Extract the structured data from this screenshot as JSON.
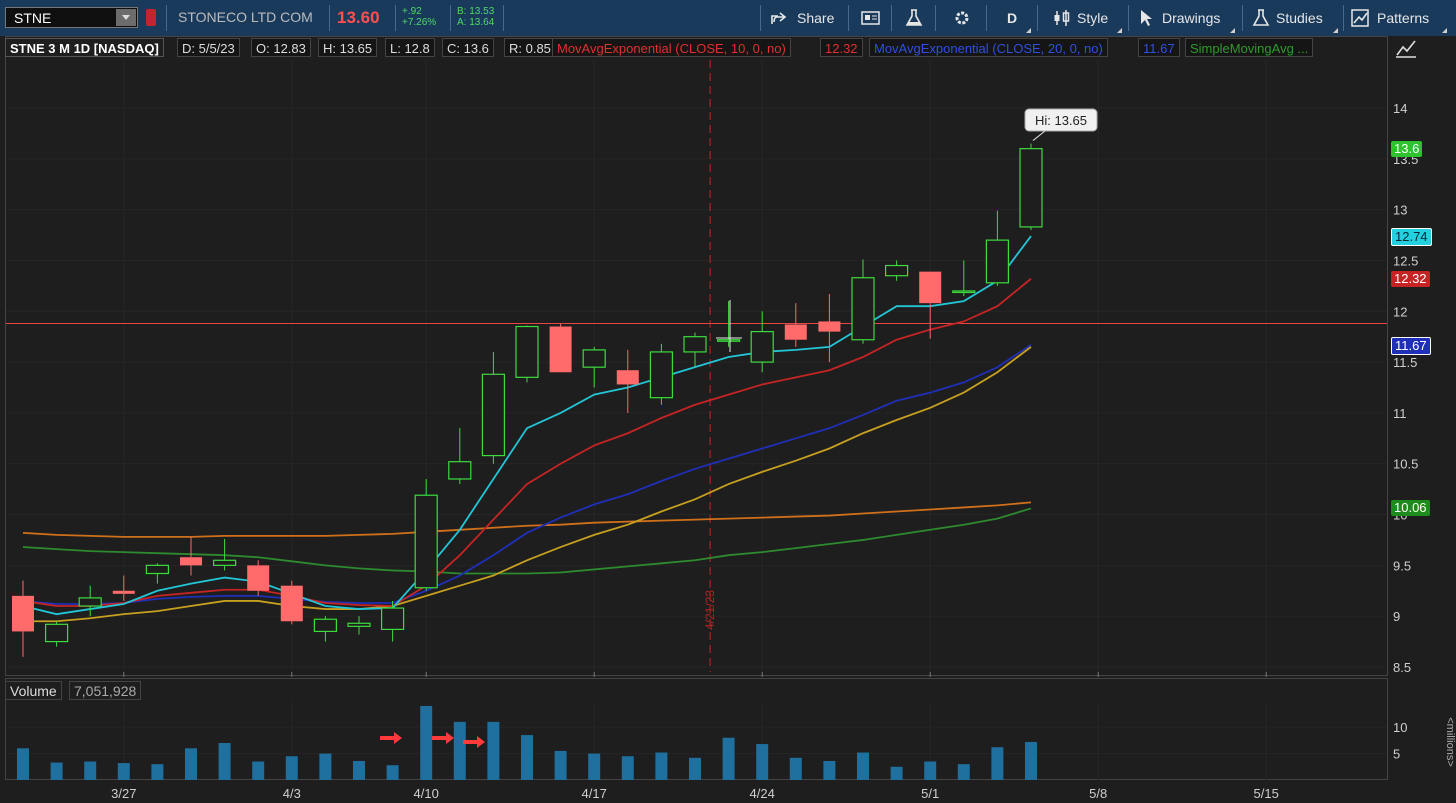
{
  "toolbar": {
    "symbol": "STNE",
    "company": "STONECO LTD COM",
    "last_price": "13.60",
    "change": "+.92",
    "change_pct": "+7.26%",
    "bid": "B: 13.53",
    "ask": "A: 13.64",
    "share_label": "Share",
    "timeframe_label": "D",
    "style_label": "Style",
    "drawings_label": "Drawings",
    "studies_label": "Studies",
    "patterns_label": "Patterns"
  },
  "studybar": {
    "title": "STNE 3 M 1D [NASDAQ]",
    "date": "D: 5/5/23",
    "open": "O: 12.83",
    "high": "H: 13.65",
    "low": "L: 12.8",
    "close": "C: 13.6",
    "range": "R: 0.85",
    "ema10_label": "MovAvgExponential (CLOSE, 10, 0, no)",
    "ema10_value": "12.32",
    "ema20_label": "MovAvgExponential (CLOSE, 20, 0, no)",
    "ema20_value": "11.67",
    "sma_label": "SimpleMovingAvg ..."
  },
  "volume_header": {
    "label": "Volume",
    "value": "7,051,928"
  },
  "price_labels": {
    "last": "13.6",
    "ema5": "12.74",
    "ema10": "12.32",
    "ema20": "11.67",
    "sma": "10.06"
  },
  "colors": {
    "up": "#3ddc3d",
    "down": "#ff6b6b",
    "ema5": "#22c6d6",
    "ema10": "#c62424",
    "ema20": "#1f2fb8",
    "sma1": "#c8a020",
    "sma2": "#d0701a",
    "sma3": "#2e8a2e",
    "volume": "#1f6f9f",
    "hline": "#e84545"
  },
  "chart_data": {
    "type": "candlestick",
    "title": "STNE 3 M 1D [NASDAQ]",
    "x_tick_labels": [
      "3/27",
      "4/3",
      "4/10",
      "4/17",
      "4/24",
      "5/1",
      "5/8",
      "5/15"
    ],
    "y_ticks": [
      8.5,
      9,
      9.5,
      10,
      10.5,
      11,
      11.5,
      12,
      12.5,
      13,
      13.5,
      14
    ],
    "ylim": [
      8.45,
      14.4
    ],
    "vertical_marker_date": "4/21/23",
    "horizontal_line": 11.88,
    "high_annotation": "Hi: 13.65",
    "candles": [
      {
        "date": "3/22",
        "o": 9.2,
        "h": 9.35,
        "l": 8.6,
        "c": 8.85
      },
      {
        "date": "3/23",
        "o": 8.75,
        "h": 8.95,
        "l": 8.7,
        "c": 8.92
      },
      {
        "date": "3/24",
        "o": 9.1,
        "h": 9.3,
        "l": 9.0,
        "c": 9.18
      },
      {
        "date": "3/27",
        "o": 9.25,
        "h": 9.4,
        "l": 9.15,
        "c": 9.22
      },
      {
        "date": "3/28",
        "o": 9.42,
        "h": 9.52,
        "l": 9.32,
        "c": 9.5
      },
      {
        "date": "3/29",
        "o": 9.58,
        "h": 9.78,
        "l": 9.4,
        "c": 9.5
      },
      {
        "date": "3/30",
        "o": 9.5,
        "h": 9.76,
        "l": 9.45,
        "c": 9.55
      },
      {
        "date": "3/31",
        "o": 9.5,
        "h": 9.55,
        "l": 9.2,
        "c": 9.25
      },
      {
        "date": "4/3",
        "o": 9.3,
        "h": 9.35,
        "l": 8.92,
        "c": 8.95
      },
      {
        "date": "4/4",
        "o": 8.85,
        "h": 9.0,
        "l": 8.75,
        "c": 8.97
      },
      {
        "date": "4/5",
        "o": 8.9,
        "h": 9.0,
        "l": 8.82,
        "c": 8.93
      },
      {
        "date": "4/6",
        "o": 8.87,
        "h": 9.15,
        "l": 8.75,
        "c": 9.08
      },
      {
        "date": "4/10",
        "o": 9.28,
        "h": 10.35,
        "l": 9.25,
        "c": 10.19
      },
      {
        "date": "4/11",
        "o": 10.35,
        "h": 10.85,
        "l": 10.3,
        "c": 10.52
      },
      {
        "date": "4/12",
        "o": 10.58,
        "h": 11.6,
        "l": 10.5,
        "c": 11.38
      },
      {
        "date": "4/13",
        "o": 11.35,
        "h": 11.86,
        "l": 11.3,
        "c": 11.85
      },
      {
        "date": "4/14",
        "o": 11.85,
        "h": 11.88,
        "l": 11.4,
        "c": 11.4
      },
      {
        "date": "4/17",
        "o": 11.45,
        "h": 11.65,
        "l": 11.25,
        "c": 11.62
      },
      {
        "date": "4/18",
        "o": 11.42,
        "h": 11.62,
        "l": 11.0,
        "c": 11.28
      },
      {
        "date": "4/19",
        "o": 11.15,
        "h": 11.68,
        "l": 11.08,
        "c": 11.6
      },
      {
        "date": "4/20",
        "o": 11.6,
        "h": 11.79,
        "l": 11.45,
        "c": 11.75
      },
      {
        "date": "4/21",
        "o": 11.72,
        "h": 12.1,
        "l": 11.65,
        "c": 11.72
      },
      {
        "date": "4/24",
        "o": 11.5,
        "h": 12.0,
        "l": 11.4,
        "c": 11.8
      },
      {
        "date": "4/25",
        "o": 11.87,
        "h": 12.08,
        "l": 11.65,
        "c": 11.72
      },
      {
        "date": "4/26",
        "o": 11.9,
        "h": 12.17,
        "l": 11.5,
        "c": 11.8
      },
      {
        "date": "4/27",
        "o": 11.72,
        "h": 12.51,
        "l": 11.68,
        "c": 12.33
      },
      {
        "date": "4/28",
        "o": 12.35,
        "h": 12.5,
        "l": 12.3,
        "c": 12.45
      },
      {
        "date": "5/1",
        "o": 12.39,
        "h": 12.39,
        "l": 11.73,
        "c": 12.08
      },
      {
        "date": "5/2",
        "o": 12.2,
        "h": 12.5,
        "l": 12.15,
        "c": 12.2
      },
      {
        "date": "5/3",
        "o": 12.28,
        "h": 12.99,
        "l": 12.25,
        "c": 12.7
      },
      {
        "date": "5/4",
        "o": 12.83,
        "h": 13.65,
        "l": 12.8,
        "c": 13.6
      }
    ],
    "ema5": [
      9.1,
      9.02,
      9.07,
      9.12,
      9.25,
      9.32,
      9.38,
      9.34,
      9.22,
      9.1,
      9.07,
      9.08,
      9.45,
      9.85,
      10.35,
      10.85,
      11.0,
      11.18,
      11.25,
      11.35,
      11.45,
      11.55,
      11.6,
      11.62,
      11.65,
      11.85,
      12.05,
      12.05,
      12.1,
      12.3,
      12.74
    ],
    "ema10": [
      9.15,
      9.1,
      9.1,
      9.13,
      9.2,
      9.23,
      9.26,
      9.26,
      9.2,
      9.13,
      9.11,
      9.1,
      9.3,
      9.6,
      9.95,
      10.3,
      10.5,
      10.68,
      10.8,
      10.95,
      11.08,
      11.18,
      11.28,
      11.35,
      11.42,
      11.55,
      11.72,
      11.82,
      11.9,
      12.05,
      12.32
    ],
    "ema20": [
      9.15,
      9.12,
      9.12,
      9.13,
      9.17,
      9.19,
      9.2,
      9.2,
      9.17,
      9.14,
      9.13,
      9.13,
      9.25,
      9.4,
      9.6,
      9.82,
      9.97,
      10.1,
      10.2,
      10.33,
      10.45,
      10.55,
      10.65,
      10.75,
      10.85,
      10.98,
      11.12,
      11.2,
      11.3,
      11.45,
      11.67
    ],
    "sma1": [
      8.95,
      8.95,
      8.98,
      9.02,
      9.05,
      9.1,
      9.15,
      9.15,
      9.1,
      9.07,
      9.07,
      9.1,
      9.2,
      9.3,
      9.4,
      9.55,
      9.68,
      9.8,
      9.9,
      10.03,
      10.15,
      10.3,
      10.42,
      10.53,
      10.65,
      10.8,
      10.93,
      11.05,
      11.2,
      11.4,
      11.65
    ],
    "sma2": [
      9.82,
      9.8,
      9.79,
      9.78,
      9.78,
      9.78,
      9.79,
      9.79,
      9.79,
      9.79,
      9.8,
      9.81,
      9.83,
      9.85,
      9.87,
      9.89,
      9.9,
      9.92,
      9.93,
      9.94,
      9.95,
      9.96,
      9.97,
      9.98,
      9.99,
      10.01,
      10.03,
      10.05,
      10.07,
      10.09,
      10.12
    ],
    "sma3": [
      9.68,
      9.66,
      9.64,
      9.63,
      9.62,
      9.61,
      9.6,
      9.58,
      9.54,
      9.5,
      9.47,
      9.45,
      9.44,
      9.42,
      9.42,
      9.42,
      9.43,
      9.46,
      9.49,
      9.52,
      9.55,
      9.6,
      9.63,
      9.67,
      9.71,
      9.75,
      9.8,
      9.85,
      9.9,
      9.96,
      10.06
    ],
    "volume": {
      "label": "Volume",
      "unit": "millions",
      "y_ticks": [
        5,
        10
      ],
      "ylim": [
        0,
        14
      ],
      "values": [
        6.0,
        3.3,
        3.5,
        3.2,
        3.0,
        6.0,
        7.0,
        3.5,
        4.5,
        5.0,
        3.6,
        2.8,
        14.0,
        11.0,
        11.0,
        8.5,
        5.5,
        5.0,
        4.5,
        5.2,
        4.2,
        8.0,
        6.8,
        4.2,
        3.6,
        5.2,
        2.5,
        3.5,
        3.0,
        6.2,
        7.2
      ]
    }
  }
}
